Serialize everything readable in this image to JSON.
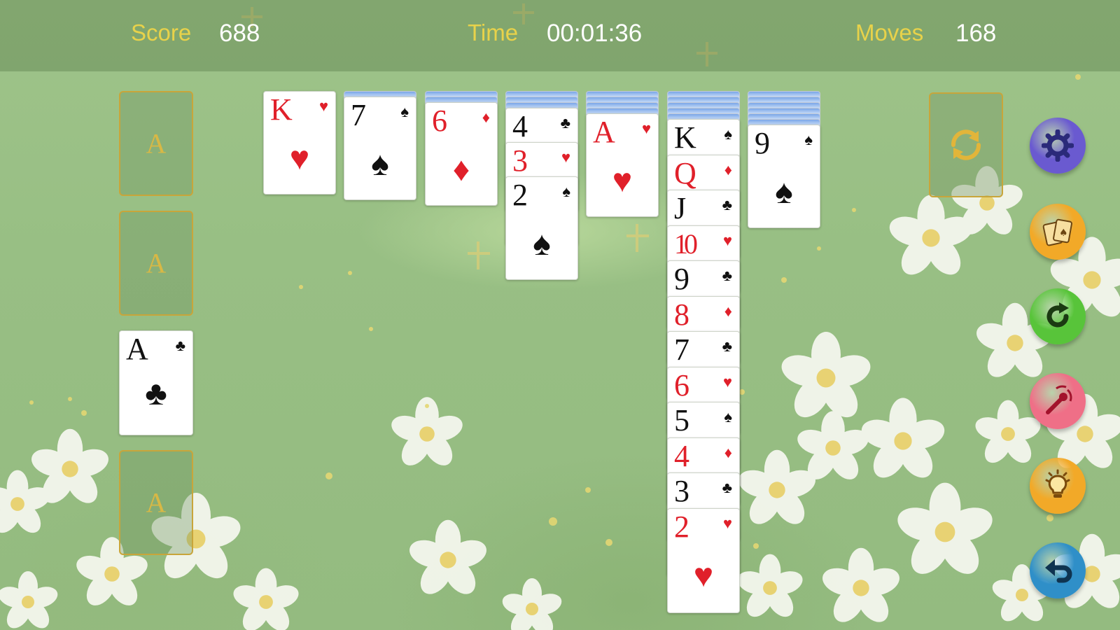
{
  "stats": {
    "score_label": "Score",
    "score_value": "688",
    "time_label": "Time",
    "time_value": "00:01:36",
    "moves_label": "Moves",
    "moves_value": "168"
  },
  "foundations": [
    {
      "letter": "A",
      "card": null
    },
    {
      "letter": "A",
      "card": null
    },
    {
      "letter": "A",
      "card": {
        "rank": "A",
        "suit": "♣"
      }
    },
    {
      "letter": "A",
      "card": null
    }
  ],
  "tableau": [
    {
      "hidden": 0,
      "cards": [
        {
          "rank": "K",
          "suit": "♥"
        }
      ]
    },
    {
      "hidden": 1,
      "cards": [
        {
          "rank": "7",
          "suit": "♠"
        }
      ]
    },
    {
      "hidden": 2,
      "cards": [
        {
          "rank": "6",
          "suit": "♦"
        }
      ]
    },
    {
      "hidden": 3,
      "cards": [
        {
          "rank": "4",
          "suit": "♣"
        },
        {
          "rank": "3",
          "suit": "♥"
        },
        {
          "rank": "2",
          "suit": "♠"
        }
      ]
    },
    {
      "hidden": 4,
      "cards": [
        {
          "rank": "A",
          "suit": "♥"
        }
      ]
    },
    {
      "hidden": 5,
      "cards": [
        {
          "rank": "K",
          "suit": "♠"
        },
        {
          "rank": "Q",
          "suit": "♦"
        },
        {
          "rank": "J",
          "suit": "♣"
        },
        {
          "rank": "10",
          "suit": "♥"
        },
        {
          "rank": "9",
          "suit": "♣"
        },
        {
          "rank": "8",
          "suit": "♦"
        },
        {
          "rank": "7",
          "suit": "♣"
        },
        {
          "rank": "6",
          "suit": "♥"
        },
        {
          "rank": "5",
          "suit": "♠"
        },
        {
          "rank": "4",
          "suit": "♦"
        },
        {
          "rank": "3",
          "suit": "♣"
        },
        {
          "rank": "2",
          "suit": "♥"
        }
      ]
    },
    {
      "hidden": 6,
      "cards": [
        {
          "rank": "9",
          "suit": "♠"
        }
      ]
    }
  ],
  "stock": {
    "icon": "recycle-icon"
  },
  "controls": [
    {
      "name": "settings-button",
      "icon": "gear-icon",
      "color": "#6a5ad0"
    },
    {
      "name": "theme-button",
      "icon": "cards-icon",
      "color": "#f2a928"
    },
    {
      "name": "restart-button",
      "icon": "refresh-icon",
      "color": "#58c43a"
    },
    {
      "name": "magic-button",
      "icon": "magic-wand-icon",
      "color": "#ef6f87"
    },
    {
      "name": "hint-button",
      "icon": "lightbulb-icon",
      "color": "#f2a928"
    },
    {
      "name": "undo-button",
      "icon": "undo-icon",
      "color": "#2f8fc8"
    }
  ],
  "colors": {
    "red_suit": "#e0202a",
    "black_suit": "#111111",
    "label_yellow": "#e8d24a",
    "slot_border": "#c8a53a"
  }
}
